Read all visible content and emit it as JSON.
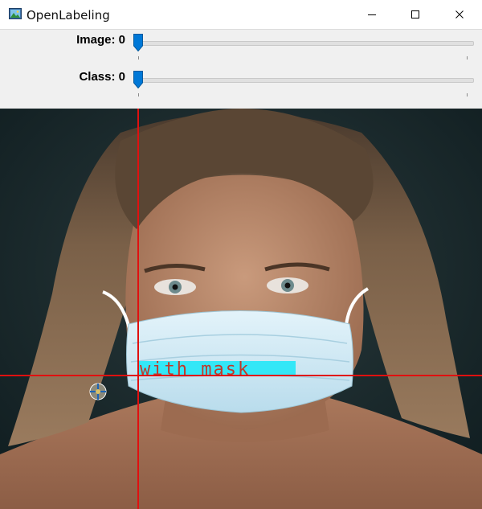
{
  "window": {
    "title": "OpenLabeling",
    "app_icon": "image-app-icon"
  },
  "window_controls": {
    "minimize": "minimize-icon",
    "maximize": "maximize-icon",
    "close": "close-icon"
  },
  "trackbars": {
    "image": {
      "label": "Image: 0",
      "value": 0
    },
    "class": {
      "label": "Class: 0",
      "value": 0
    }
  },
  "annotation": {
    "label": "with mask",
    "label_bg": "#33e7f7",
    "label_color": "#c0392b"
  },
  "crosshair": {
    "color": "#e01010"
  },
  "colors": {
    "accent": "#0078d7",
    "background": "#f0f0f0"
  }
}
